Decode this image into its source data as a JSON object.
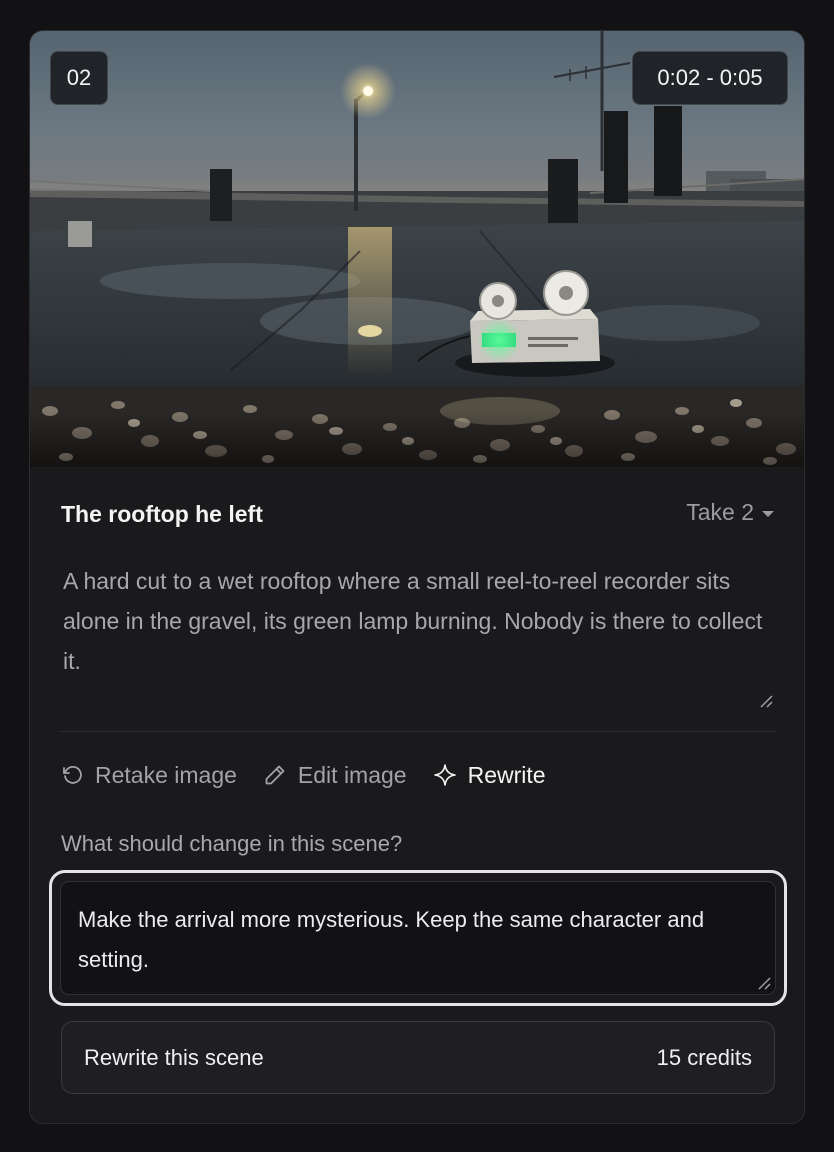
{
  "scene": {
    "number": "02",
    "timecode": "0:02 - 0:05",
    "title": "The rooftop he left",
    "take_label": "Take 2",
    "description": "A hard cut to a wet rooftop where a small reel-to-reel recorder sits alone in the gravel, its green lamp burning. Nobody is there to collect it."
  },
  "actions": {
    "retake_label": "Retake image",
    "edit_label": "Edit image",
    "rewrite_label": "Rewrite"
  },
  "rewrite": {
    "prompt_label": "What should change in this scene?",
    "prompt_value": "Make the arrival more mysterious. Keep the same character and setting.",
    "submit_label": "Rewrite this scene",
    "cost_label": "15 credits"
  },
  "icons": {
    "retake": "rotate-ccw-icon",
    "edit": "pencil-icon",
    "rewrite": "sparkle-icon",
    "take_dropdown": "caret-down-icon"
  },
  "colors": {
    "accent_lamp": "#3ddc84",
    "card_bg": "#1a1a1c",
    "page_bg": "#121214"
  }
}
